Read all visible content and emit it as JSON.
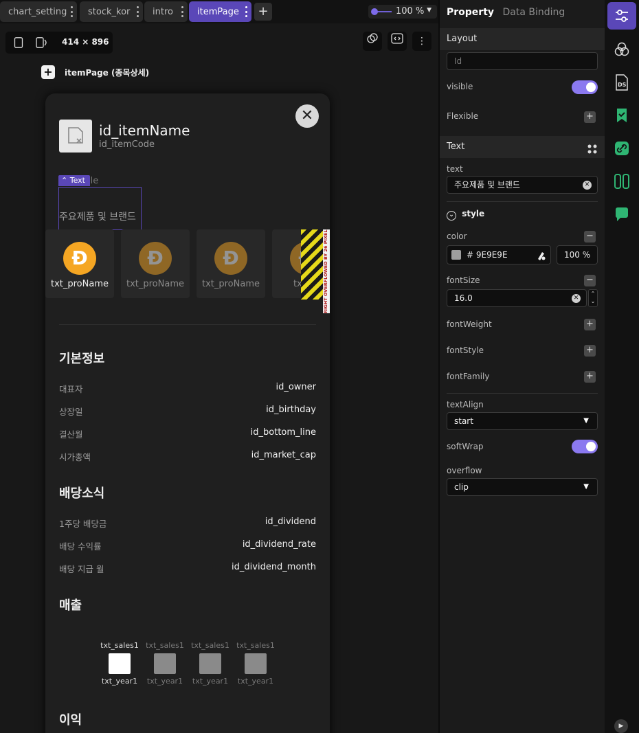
{
  "tabs": [
    {
      "label": "chart_setting"
    },
    {
      "label": "stock_kor"
    },
    {
      "label": "intro"
    },
    {
      "label": "itemPage"
    }
  ],
  "zoom": {
    "value": "100 %"
  },
  "canvas": {
    "device_size": "414 × 896",
    "page_title": "itemPage (종목상세)"
  },
  "phone": {
    "item_name": "id_itemName",
    "item_code": "id_itemCode",
    "ghost_label": "ile",
    "text_chip": "Text",
    "selected_text": "주요제품 및 브랜드",
    "products": [
      "txt_proName",
      "txt_proName",
      "txt_proName",
      "txt_pr"
    ],
    "overflow_label": "RIGHT OVERFLOWED BY 26 PIXELS",
    "basic_info": {
      "title": "기본정보",
      "rows": [
        {
          "k": "대표자",
          "v": "id_owner"
        },
        {
          "k": "상장일",
          "v": "id_birthday"
        },
        {
          "k": "결산월",
          "v": "id_bottom_line"
        },
        {
          "k": "시가총액",
          "v": "id_market_cap"
        }
      ]
    },
    "dividend": {
      "title": "배당소식",
      "rows": [
        {
          "k": "1주당 배당금",
          "v": "id_dividend"
        },
        {
          "k": "배당 수익률",
          "v": "id_dividend_rate"
        },
        {
          "k": "배당 지급 월",
          "v": "id_dividend_month"
        }
      ]
    },
    "sales": {
      "title": "매출",
      "items": [
        {
          "label": "txt_sales1",
          "year": "txt_year1"
        },
        {
          "label": "txt_sales1",
          "year": "txt_year1"
        },
        {
          "label": "txt_sales1",
          "year": "txt_year1"
        },
        {
          "label": "txt_sales1",
          "year": "txt_year1"
        }
      ]
    },
    "profit": {
      "title": "이익"
    }
  },
  "panel": {
    "tab_property": "Property",
    "tab_binding": "Data Binding",
    "layout_header": "Layout",
    "id_placeholder": "Id",
    "visible_label": "visible",
    "flexible_label": "Flexible",
    "text_header": "Text",
    "text_label": "text",
    "text_value": "주요제품 및 브랜드",
    "style_label": "style",
    "color_label": "color",
    "color_hex": "# 9E9E9E",
    "color_opacity": "100 %",
    "color_swatch": "#9E9E9E",
    "fontsize_label": "fontSize",
    "fontsize_value": "16.0",
    "fontweight_label": "fontWeight",
    "fontstyle_label": "fontStyle",
    "fontfamily_label": "fontFamily",
    "textalign_label": "textAlign",
    "textalign_value": "start",
    "softwrap_label": "softWrap",
    "overflow_label": "overflow",
    "overflow_value": "clip"
  },
  "colors": {
    "accent": "#5A47B8",
    "toggle": "#8B79F0",
    "coin": "#F5A623"
  }
}
